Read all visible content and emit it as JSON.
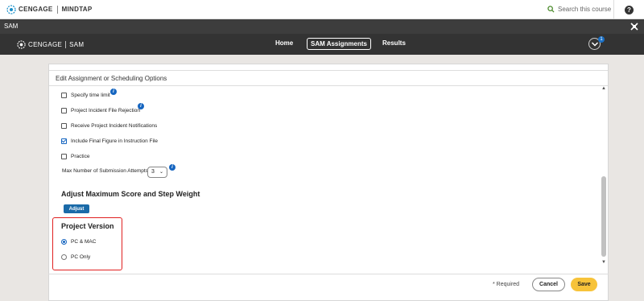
{
  "topbar": {
    "brand": "CENGAGE",
    "product": "MINDTAP",
    "search_placeholder": "Search this course",
    "help_label": "?"
  },
  "samstrip": {
    "label": "SAM"
  },
  "nav": {
    "brand": "CENGAGE",
    "product": "SAM",
    "tabs": [
      {
        "label": "Home"
      },
      {
        "label": "SAM Assignments",
        "active": true
      },
      {
        "label": "Results"
      }
    ],
    "notification_count": "1"
  },
  "panel": {
    "title": "Edit Assignment or Scheduling Options",
    "options": [
      {
        "label": "Specify time limit",
        "checked": false
      },
      {
        "label": "Project Incident File Rejection",
        "checked": false
      },
      {
        "label": "Receive Project Incident Notifications",
        "checked": false
      },
      {
        "label": "Include Final Figure in Instruction File",
        "checked": true
      },
      {
        "label": "Practice",
        "checked": false
      }
    ],
    "max_attempts_label": "Max Number of Submission Attempts",
    "max_attempts_value": "3",
    "adjust_heading": "Adjust Maximum Score and Step Weight",
    "adjust_button": "Adjust",
    "version_heading": "Project Version",
    "version_options": [
      {
        "label": "PC & MAC",
        "selected": true
      },
      {
        "label": "PC Only",
        "selected": false
      }
    ]
  },
  "footer": {
    "required_note": "* Required",
    "cancel_label": "Cancel",
    "save_label": "Save"
  },
  "colors": {
    "accent_blue": "#1565c0",
    "save_yellow": "#f7c33a",
    "highlight_red": "#e02020",
    "nav_dark": "#333333"
  }
}
